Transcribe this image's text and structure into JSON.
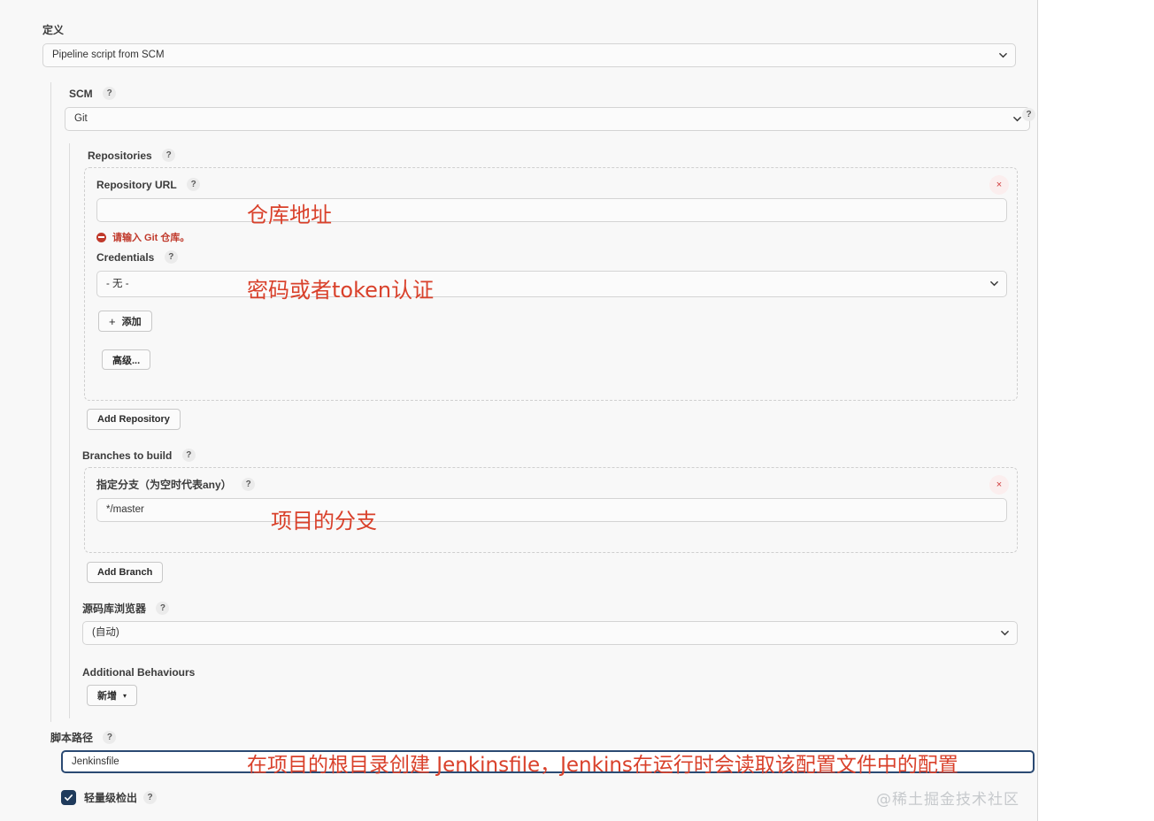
{
  "definition": {
    "label": "定义",
    "value": "Pipeline script from SCM"
  },
  "scm": {
    "label": "SCM",
    "help": "?",
    "value": "Git",
    "outer_help": "?"
  },
  "repositories": {
    "label": "Repositories",
    "help": "?",
    "repository_url": {
      "label": "Repository URL",
      "help": "?",
      "value": "",
      "error": "请输入 Git 仓库。"
    },
    "credentials": {
      "label": "Credentials",
      "help": "?",
      "value": "- 无 -",
      "add_button": "添加",
      "add_plus": "+",
      "advanced_button": "高级..."
    },
    "delete_icon": "×",
    "add_repository_button": "Add Repository"
  },
  "branches": {
    "label": "Branches to build",
    "help": "?",
    "specifier": {
      "label": "指定分支（为空时代表any）",
      "help": "?",
      "value": "*/master"
    },
    "delete_icon": "×",
    "add_branch_button": "Add Branch"
  },
  "repo_browser": {
    "label": "源码库浏览器",
    "help": "?",
    "value": "(自动)"
  },
  "additional_behaviours": {
    "label": "Additional Behaviours",
    "add_button": "新增",
    "caret": "▾"
  },
  "script_path": {
    "label": "脚本路径",
    "help": "?",
    "value": "Jenkinsfile"
  },
  "lightweight_checkout": {
    "label": "轻量级检出",
    "help": "?",
    "checked": true
  },
  "annotations": {
    "repo_url": "仓库地址",
    "credentials": "密码或者token认证",
    "branch": "项目的分支",
    "script_path": "在项目的根目录创建 Jenkinsfile，Jenkins在运行时会读取该配置文件中的配置"
  },
  "watermark": "@稀土掘金技术社区",
  "colors": {
    "annotation": "#d9412b",
    "error": "#c0392b",
    "checkbox": "#1f3b5c",
    "focus_border": "#2b4a73"
  }
}
